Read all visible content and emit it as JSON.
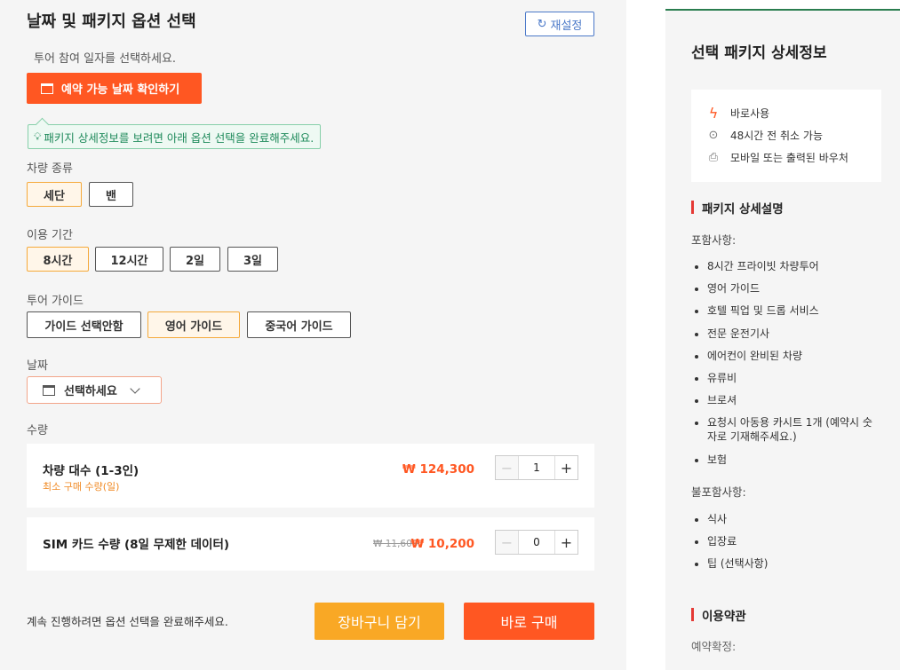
{
  "options": {
    "title": "날짜 및 패키지 옵션 선택",
    "reset_label": "재설정",
    "subtitle": "투어 참여 일자를 선택하세요.",
    "check_date_label": "예약 가능 날짜 확인하기",
    "notice": "패키지 상세정보를 보려면 아래 옵션 선택을 완료해주세요.",
    "vehicle": {
      "label": "차량 종류",
      "items": [
        "세단",
        "밴"
      ],
      "selected": "세단"
    },
    "duration": {
      "label": "이용 기간",
      "items": [
        "8시간",
        "12시간",
        "2일",
        "3일"
      ],
      "selected": "8시간"
    },
    "guide": {
      "label": "투어 가이드",
      "items": [
        "가이드 선택안함",
        "영어 가이드",
        "중국어 가이드"
      ],
      "selected": "영어 가이드"
    },
    "date": {
      "label": "날짜",
      "placeholder": "선택하세요"
    },
    "quantity": {
      "label": "수량",
      "rows": [
        {
          "name": "차량 대수 (1-3인)",
          "sub": "최소 구매 수량(일)",
          "price": "₩ 124,300",
          "old_price": "",
          "value": "1"
        },
        {
          "name": "SIM 카드 수량 (8일 무제한 데이터)",
          "sub": "",
          "price": "₩ 10,200",
          "old_price": "₩ 11,600",
          "value": "0"
        }
      ]
    },
    "footer_note": "계속 진행하려면 옵션 선택을 완료해주세요.",
    "cart_label": "장바구니 담기",
    "buy_label": "바로 구매"
  },
  "details": {
    "title": "선택 패키지 상세정보",
    "features": [
      {
        "icon": "lightning-icon",
        "text": "바로사용"
      },
      {
        "icon": "refund-icon",
        "text": "48시간 전 취소 가능"
      },
      {
        "icon": "voucher-icon",
        "text": "모바일 또는 출력된 바우처"
      }
    ],
    "package_heading": "패키지 상세설명",
    "included_label": "포함사항:",
    "included": [
      "8시간 프라이빗 차량투어",
      "영어 가이드",
      "호텔 픽업 및 드롭 서비스",
      "전문 운전기사",
      "에어컨이 완비된 차량",
      "유류비",
      "브로셔",
      "요청시 아동용 카시트 1개 (예약시 숫자로 기재해주세요.)",
      "보험"
    ],
    "excluded_label": "불포함사항:",
    "excluded": [
      "식사",
      "입장료",
      "팁 (선택사항)"
    ],
    "terms_heading": "이용약관",
    "confirm_label": "예약확정:"
  },
  "colors": {
    "accent": "#ff5722",
    "cart": "#f9a825",
    "notice": "#1f8a5b",
    "selected_border": "#f5a93a",
    "link": "#4a78c8"
  }
}
